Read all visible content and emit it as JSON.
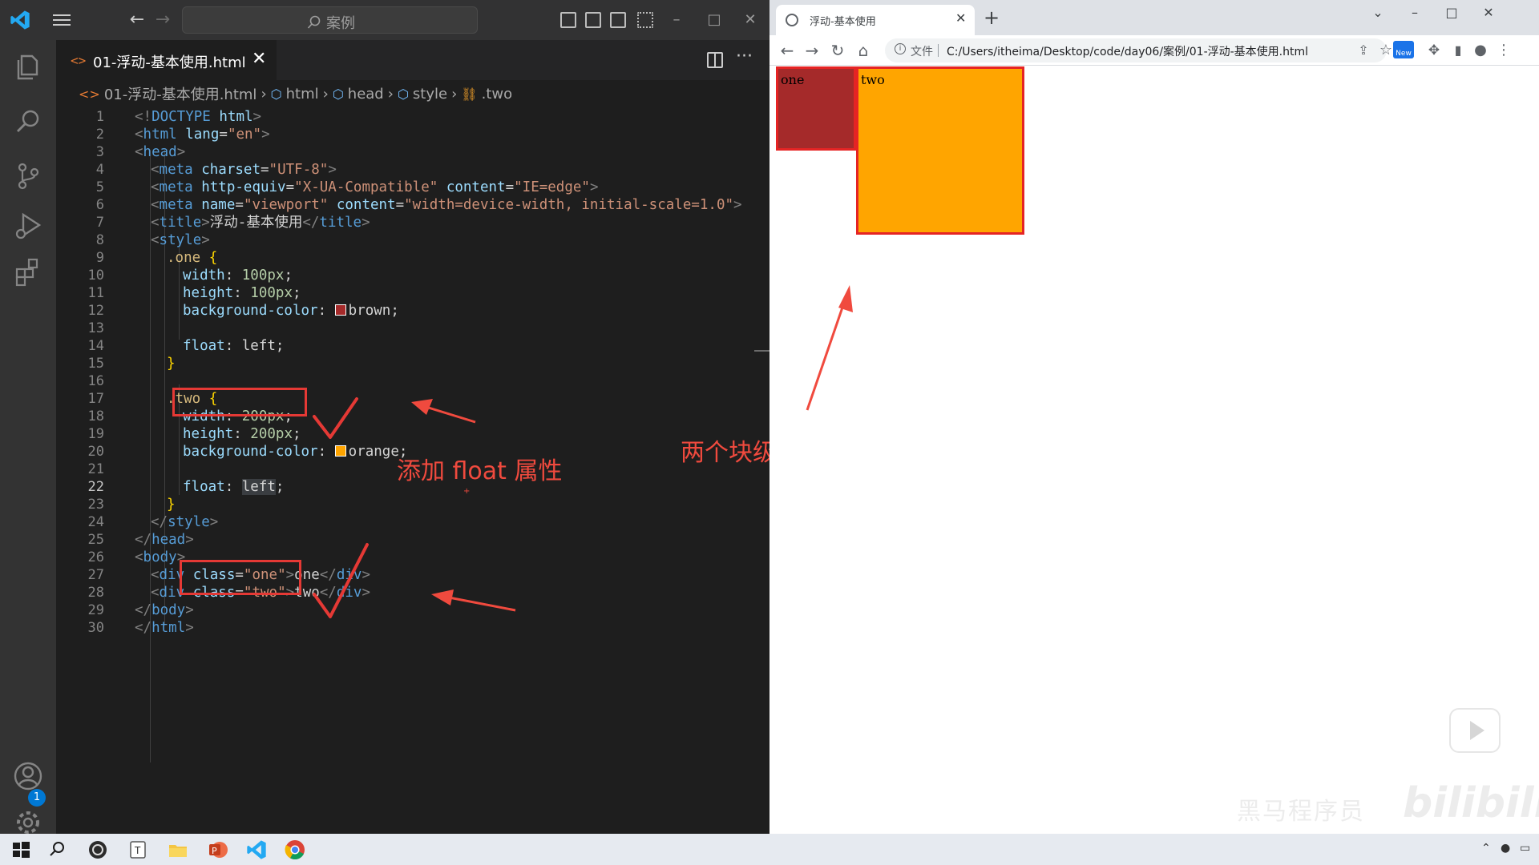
{
  "vscode": {
    "search_placeholder": "案例",
    "tab_title": "01-浮动-基本使用.html",
    "tab_icon": "<>",
    "account_badge": "1",
    "breadcrumb": {
      "file": "01-浮动-基本使用.html",
      "items": [
        "html",
        "head",
        "style",
        ".two"
      ]
    },
    "line_numbers": [
      "1",
      "2",
      "3",
      "4",
      "5",
      "6",
      "7",
      "8",
      "9",
      "10",
      "11",
      "12",
      "13",
      "14",
      "15",
      "16",
      "17",
      "18",
      "19",
      "20",
      "21",
      "22",
      "23",
      "24",
      "25",
      "26",
      "27",
      "28",
      "29",
      "30"
    ],
    "active_line": "22",
    "code": {
      "l1": [
        "<!",
        "DOCTYPE",
        " html",
        ">"
      ],
      "l2": [
        "<",
        "html",
        " lang",
        "=",
        "\"en\"",
        ">"
      ],
      "l3": [
        "<",
        "head",
        ">"
      ],
      "l4": [
        "<",
        "meta",
        " charset",
        "=",
        "\"UTF-8\"",
        ">"
      ],
      "l5": [
        "<",
        "meta",
        " http-equiv",
        "=",
        "\"X-UA-Compatible\"",
        " content",
        "=",
        "\"IE=edge\"",
        ">"
      ],
      "l6": [
        "<",
        "meta",
        " name",
        "=",
        "\"viewport\"",
        " content",
        "=",
        "\"width=device-width, initial-scale=1.0\"",
        ">"
      ],
      "l7": [
        "<",
        "title",
        ">",
        "浮动-基本使用",
        "</",
        "title",
        ">"
      ],
      "l8": [
        "<",
        "style",
        ">"
      ],
      "l9": [
        ".one",
        " {"
      ],
      "l10": [
        "width",
        ": ",
        "100px",
        ";"
      ],
      "l11": [
        "height",
        ": ",
        "100px",
        ";"
      ],
      "l12": [
        "background-color",
        ": ",
        "brown",
        ";"
      ],
      "l14": [
        "float",
        ": ",
        "left",
        ";"
      ],
      "l15": [
        "}"
      ],
      "l17": [
        ".two",
        " {"
      ],
      "l18": [
        "width",
        ": ",
        "200px",
        ";"
      ],
      "l19": [
        "height",
        ": ",
        "200px",
        ";"
      ],
      "l20": [
        "background-color",
        ": ",
        "orange",
        ";"
      ],
      "l22": [
        "float",
        ": ",
        "left",
        ";"
      ],
      "l23": [
        "}"
      ],
      "l24": [
        "</",
        "style",
        ">"
      ],
      "l25": [
        "</",
        "head",
        ">"
      ],
      "l26": [
        "<",
        "body",
        ">"
      ],
      "l27": [
        "<",
        "div",
        " class",
        "=",
        "\"one\"",
        ">",
        "one",
        "</",
        "div",
        ">"
      ],
      "l28": [
        "<",
        "div",
        " class",
        "=",
        "\"two\"",
        ">",
        "two",
        "</",
        "div",
        ">"
      ],
      "l29": [
        "</",
        "body",
        ">"
      ],
      "l30": [
        "</",
        "html",
        ">"
      ]
    },
    "swatch_colors": {
      "brown": "#a52a2a",
      "orange": "#ffa500"
    }
  },
  "annotations": {
    "add_float": "添加 float 属性",
    "same_line": "两个块级元素显示在了一行",
    "color": "#f04a3e"
  },
  "chrome": {
    "tab_title": "浮动-基本使用",
    "scheme_label": "文件",
    "url": "C:/Users/itheima/Desktop/code/day06/案例/01-浮动-基本使用.html",
    "new_badge": "New",
    "page": {
      "one_text": "one",
      "two_text": "two"
    },
    "watermark": "黑马程序员",
    "watermark2": "bilibili"
  },
  "taskbar": {
    "items": [
      "windows-start",
      "search",
      "obs",
      "typora",
      "file-explorer",
      "powerpoint",
      "vscode",
      "chrome"
    ]
  }
}
